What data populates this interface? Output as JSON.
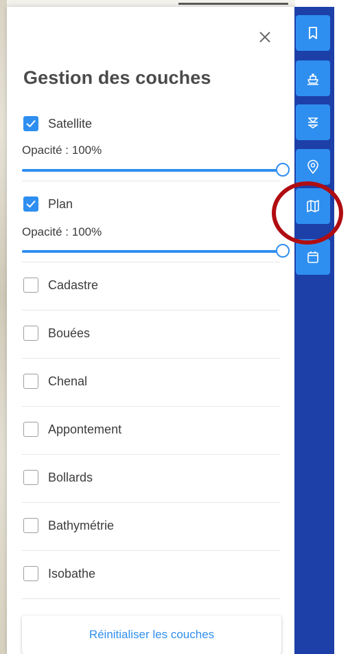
{
  "panel": {
    "title": "Gestion des couches",
    "close_icon": "close-icon",
    "reset_label": "Réinitialiser les couches"
  },
  "layers_with_opacity": [
    {
      "label": "Satellite",
      "checked": true,
      "opacity_label": "Opacité : 100%",
      "opacity": 1.0
    },
    {
      "label": "Plan",
      "checked": true,
      "opacity_label": "Opacité : 100%",
      "opacity": 1.0
    }
  ],
  "layers": [
    {
      "label": "Cadastre",
      "checked": false
    },
    {
      "label": "Bouées",
      "checked": false
    },
    {
      "label": "Chenal",
      "checked": false
    },
    {
      "label": "Appontement",
      "checked": false
    },
    {
      "label": "Bollards",
      "checked": false
    },
    {
      "label": "Bathymétrie",
      "checked": false
    },
    {
      "label": "Isobathe",
      "checked": false
    }
  ],
  "sidebar": {
    "buttons": [
      {
        "icon": "bookmark-icon"
      },
      {
        "icon": "ship-icon"
      },
      {
        "icon": "dock-icon"
      },
      {
        "icon": "anchor-pin-icon"
      },
      {
        "icon": "map-icon"
      },
      {
        "icon": "calendar-icon"
      }
    ]
  },
  "colors": {
    "accent": "#2f8ff0",
    "sidebar": "#1c3fa8",
    "highlight": "#b00d12"
  }
}
